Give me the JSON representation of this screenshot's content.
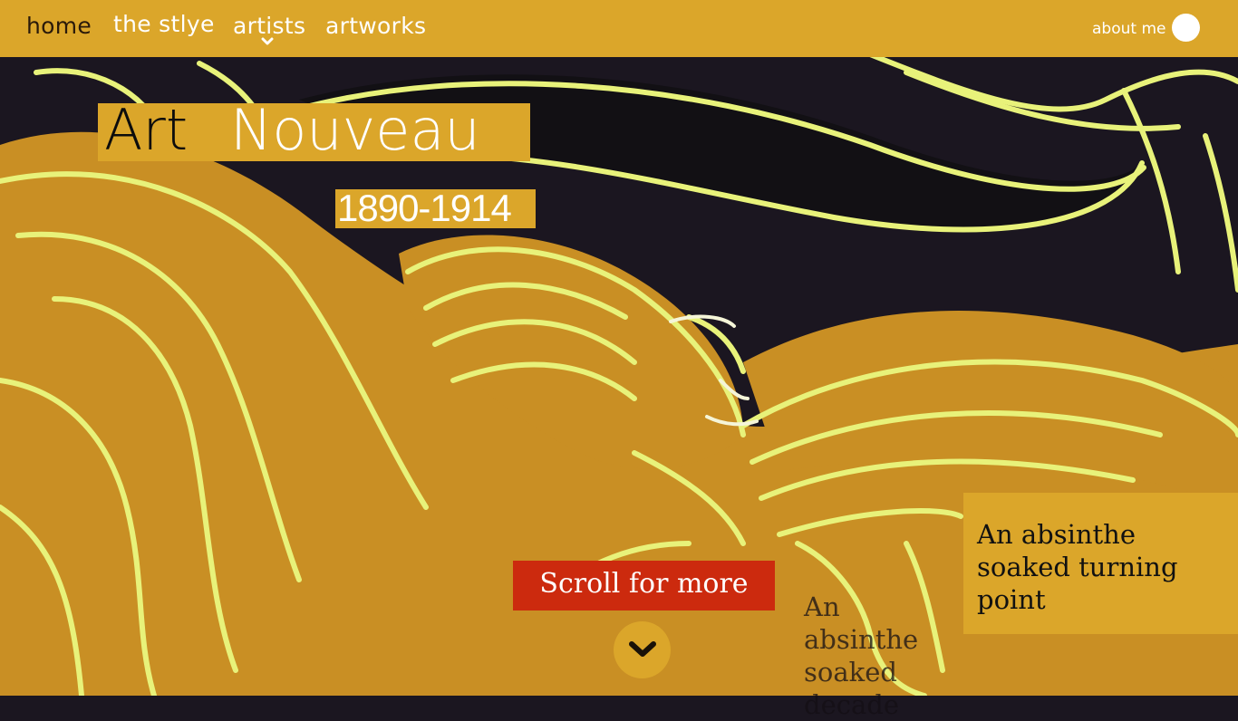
{
  "nav": {
    "home": "home",
    "style": "the stlye",
    "artists": "artists",
    "artworks": "artworks",
    "about": "about me"
  },
  "hero": {
    "title_part1": "Art",
    "title_part2": "Nouveau",
    "years": "1890-1914"
  },
  "scroll": {
    "label": "Scroll for more"
  },
  "card": {
    "text": "An absinthe soaked turning point",
    "ghost_text": "An absinthe soaked decade"
  },
  "colors": {
    "accent": "#dba62a",
    "scroll_button": "#cc2a0e",
    "artwork_dark": "#1b1620",
    "artwork_gold": "#c98f24",
    "artwork_line": "#e8f27a"
  }
}
